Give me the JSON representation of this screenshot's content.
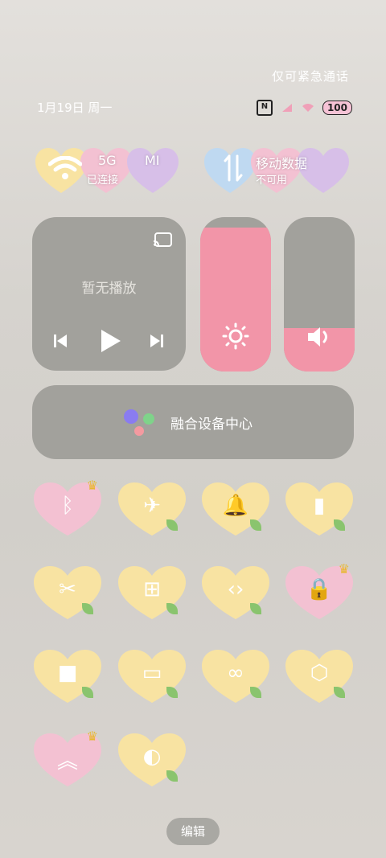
{
  "header": {
    "emergency_text": "仅可紧急通话",
    "date_text": "1月19日 周一",
    "battery_text": "100"
  },
  "network_cards": {
    "wifi": {
      "line1": "5G",
      "line1b": "MI",
      "line2": "已连接"
    },
    "mobile": {
      "line1": "移动数据",
      "line2": "不可用"
    }
  },
  "media": {
    "title": "暂无播放"
  },
  "sliders": {
    "brightness_level": 0.93,
    "volume_level": 0.28
  },
  "hub": {
    "label": "融合设备中心"
  },
  "toggles": [
    {
      "name": "bluetooth",
      "glyph": "ᛒ",
      "color": "pink",
      "crown": true
    },
    {
      "name": "airplane",
      "glyph": "✈",
      "color": "yellow"
    },
    {
      "name": "bell",
      "glyph": "🔔",
      "color": "yellow"
    },
    {
      "name": "flashlight",
      "glyph": "▮",
      "color": "yellow"
    },
    {
      "name": "screenshot",
      "glyph": "✂",
      "color": "yellow"
    },
    {
      "name": "battery-saver",
      "glyph": "⊞",
      "color": "yellow"
    },
    {
      "name": "code",
      "glyph": "‹›",
      "color": "yellow"
    },
    {
      "name": "rotation-lock",
      "glyph": "🔒",
      "color": "pink",
      "crown": true
    },
    {
      "name": "video",
      "glyph": "■",
      "color": "yellow"
    },
    {
      "name": "cast",
      "glyph": "▭",
      "color": "yellow"
    },
    {
      "name": "link",
      "glyph": "∞",
      "color": "yellow"
    },
    {
      "name": "settings",
      "glyph": "⬡",
      "color": "yellow"
    },
    {
      "name": "boost",
      "glyph": "︽",
      "color": "pink",
      "crown": true
    },
    {
      "name": "dark-mode",
      "glyph": "◐",
      "color": "yellow"
    }
  ],
  "edit_label": "编辑",
  "colors": {
    "yellow_heart": "#f8e3a2",
    "pink_heart": "#f3c1d2",
    "tile_gray": "#a2a19c",
    "accent_pink": "#f295a8"
  }
}
